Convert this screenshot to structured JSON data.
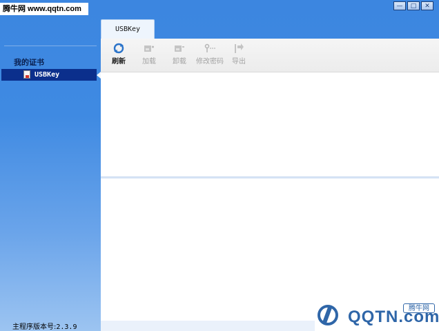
{
  "watermark": {
    "top_text": "腾牛网 www.qqtn.com",
    "logo_text": "QQTN.com",
    "logo_badge": "腾牛网"
  },
  "window": {
    "controls": {
      "minimize": "—",
      "maximize": "□",
      "close": "✕"
    }
  },
  "tabs": [
    {
      "label": "USBKey",
      "selected": true
    }
  ],
  "sidebar": {
    "heading": "我的证书",
    "items": [
      {
        "label": "USBKey",
        "icon": "usb-key-icon",
        "selected": true
      }
    ],
    "version_label": "主程序版本号:",
    "version_value": "2.3.9"
  },
  "toolbar": {
    "buttons": [
      {
        "label": "刷新",
        "icon": "refresh-icon",
        "enabled": true
      },
      {
        "label": "加载",
        "icon": "load-icon",
        "enabled": false
      },
      {
        "label": "卸载",
        "icon": "unload-icon",
        "enabled": false
      },
      {
        "label": "修改密码",
        "icon": "key-password-icon",
        "enabled": false
      },
      {
        "label": "导出",
        "icon": "export-icon",
        "enabled": false
      }
    ]
  },
  "colors": {
    "sidebar_selected": "#0b2f8c",
    "window_blue": "#3f8ae2",
    "accent_refresh": "#2a73c9"
  }
}
